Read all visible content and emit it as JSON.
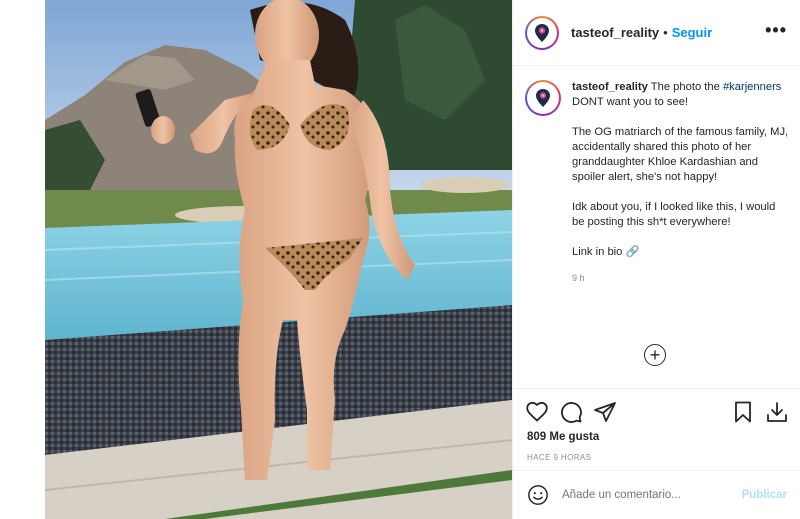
{
  "header": {
    "username": "tasteof_reality",
    "separator": "•",
    "follow_label": "Seguir",
    "more_label": "•••"
  },
  "caption": {
    "username": "tasteof_reality",
    "line_intro": "The photo the",
    "hashtag": "#karjenners",
    "line_rest": "DONT want you to see!",
    "paragraph_2": "The OG matriarch of the famous family, MJ, accidentally shared this photo of her granddaughter Khloe Kardashian and spoiler alert, she's not happy!",
    "paragraph_3": "Idk about you, if I looked like this, I would be posting this sh*t everywhere!",
    "paragraph_4": "Link in bio",
    "link_emoji": "🔗",
    "time": "9 h"
  },
  "load_more_label": "+",
  "actions": {
    "likes": "809 Me gusta",
    "time_ago": "HACE 9 HORAS"
  },
  "add_comment": {
    "placeholder": "Añade un comentario...",
    "publish_label": "Publicar"
  },
  "colors": {
    "accent_blue": "#0095f6",
    "publish_disabled": "#b2dffc",
    "text": "#262626",
    "muted": "#8e8e8e"
  },
  "icons": {
    "like": "heart-icon",
    "comment": "comment-icon",
    "share": "paper-plane-icon",
    "save": "bookmark-icon",
    "download": "download-icon",
    "emoji": "smiley-icon",
    "avatar": "location-pin-logo-icon"
  }
}
